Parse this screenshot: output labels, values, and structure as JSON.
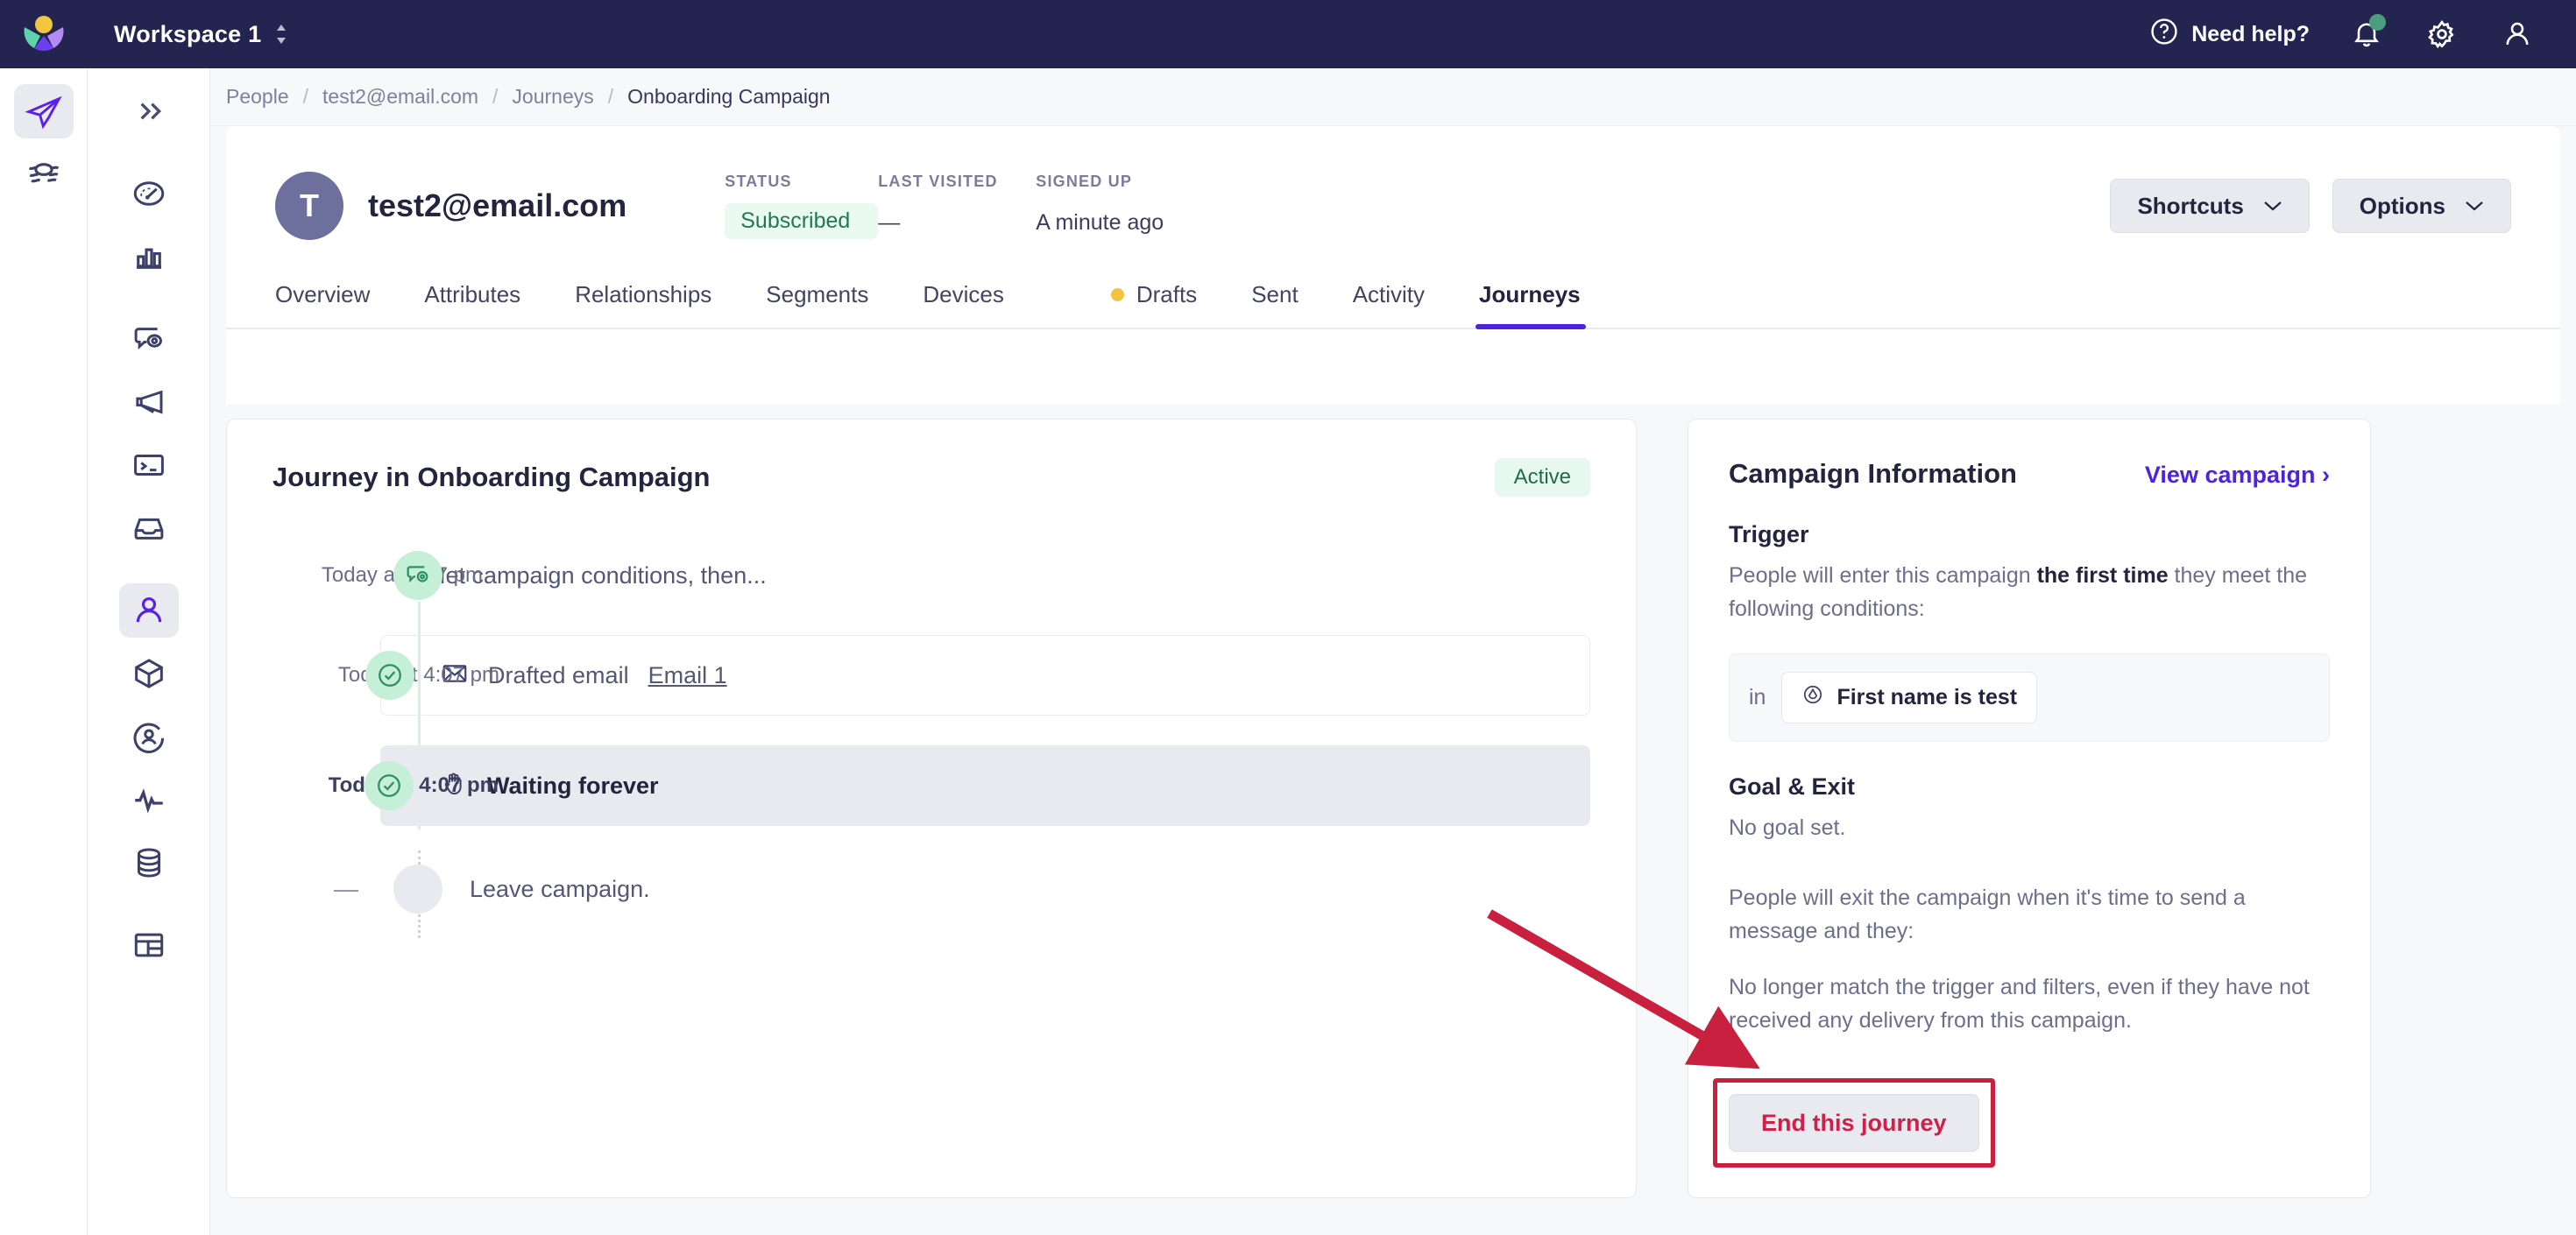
{
  "topbar": {
    "workspace": "Workspace 1",
    "need_help": "Need help?",
    "icons": {
      "help": "help-circle-icon",
      "bell": "bell-icon",
      "gear": "gear-icon",
      "user": "user-icon"
    },
    "bg_color": "#242451",
    "notification_dot_color": "#4a9e7f"
  },
  "rail_primary": {
    "items": [
      {
        "name": "paper-plane-icon",
        "active": true
      },
      {
        "name": "layers-icon",
        "active": false
      }
    ]
  },
  "rail_secondary": {
    "items": [
      {
        "name": "chevrons-right-icon",
        "active": false
      },
      {
        "name": "dashboard-gauge-icon",
        "active": false
      },
      {
        "name": "bar-chart-icon",
        "active": false
      },
      {
        "name": "message-eye-icon",
        "active": false
      },
      {
        "name": "megaphone-icon",
        "active": false
      },
      {
        "name": "terminal-icon",
        "active": false
      },
      {
        "name": "inbox-icon",
        "active": false
      },
      {
        "name": "person-icon",
        "active": true
      },
      {
        "name": "box-icon",
        "active": false
      },
      {
        "name": "user-circle-icon",
        "active": false
      },
      {
        "name": "activity-pulse-icon",
        "active": false
      },
      {
        "name": "database-icon",
        "active": false
      },
      {
        "name": "table-icon",
        "active": false
      }
    ]
  },
  "breadcrumb": {
    "items": [
      "People",
      "test2@email.com",
      "Journeys",
      "Onboarding Campaign"
    ],
    "separator": "/"
  },
  "person": {
    "avatar_initial": "T",
    "email": "test2@email.com",
    "meta": [
      {
        "label": "STATUS",
        "value": "Subscribed",
        "is_badge": true
      },
      {
        "label": "LAST VISITED",
        "value": "—",
        "is_badge": false
      },
      {
        "label": "SIGNED UP",
        "value": "A minute ago",
        "is_badge": false
      }
    ],
    "buttons": [
      {
        "label": "Shortcuts",
        "caret": "⌄"
      },
      {
        "label": "Options",
        "caret": "⌄"
      }
    ]
  },
  "tabs": [
    {
      "label": "Overview",
      "active": false,
      "dot": false
    },
    {
      "label": "Attributes",
      "active": false,
      "dot": false
    },
    {
      "label": "Relationships",
      "active": false,
      "dot": false
    },
    {
      "label": "Segments",
      "active": false,
      "dot": false
    },
    {
      "label": "Devices",
      "active": false,
      "dot": false
    },
    {
      "label": "Drafts",
      "active": false,
      "dot": true
    },
    {
      "label": "Sent",
      "active": false,
      "dot": false
    },
    {
      "label": "Activity",
      "active": false,
      "dot": false
    },
    {
      "label": "Journeys",
      "active": true,
      "dot": false
    }
  ],
  "journey": {
    "title": "Journey in Onboarding Campaign",
    "status_badge": "Active",
    "steps": [
      {
        "time": "Today at 4:07 pm",
        "text": "Met campaign conditions, then...",
        "node": "campaign-conditions-icon",
        "node_style": "green",
        "style": "plain",
        "bold": false
      },
      {
        "time": "Today at 4:07 pm",
        "text_prefix": "Drafted email ",
        "link": "Email 1",
        "node": "check-circle-icon",
        "node_style": "green",
        "style": "boxed",
        "icon": "envelope-icon",
        "bold": false
      },
      {
        "time": "Today at 4:07 pm",
        "text": "Waiting forever",
        "node": "check-circle-icon",
        "node_style": "green",
        "style": "highlight",
        "icon": "raised-hand-icon",
        "bold": true
      },
      {
        "time": "—",
        "text": "Leave campaign.",
        "node": "empty-circle-icon",
        "node_style": "grey",
        "style": "last",
        "bold": false
      }
    ]
  },
  "campaign_info": {
    "title": "Campaign Information",
    "view_link": "View campaign",
    "view_link_chevron": "›",
    "trigger_heading": "Trigger",
    "trigger_text_1": "People will enter this campaign ",
    "trigger_text_bold": "the first time",
    "trigger_text_2": " they meet the following conditions:",
    "condition_in": "in",
    "condition_chip": "First name is test",
    "condition_chip_icon": "segment-icon",
    "goal_heading": "Goal & Exit",
    "goal_text": "No goal set.",
    "exit_text_1": "People will exit the campaign when it's time to send a message and they:",
    "exit_text_2": "No longer match the trigger and filters, even if they have not received any delivery from this campaign.",
    "end_button": "End this journey",
    "end_button_color": "#d0204a",
    "highlight_color": "#c9203f"
  },
  "annotation": {
    "arrow_color": "#c9203f"
  }
}
